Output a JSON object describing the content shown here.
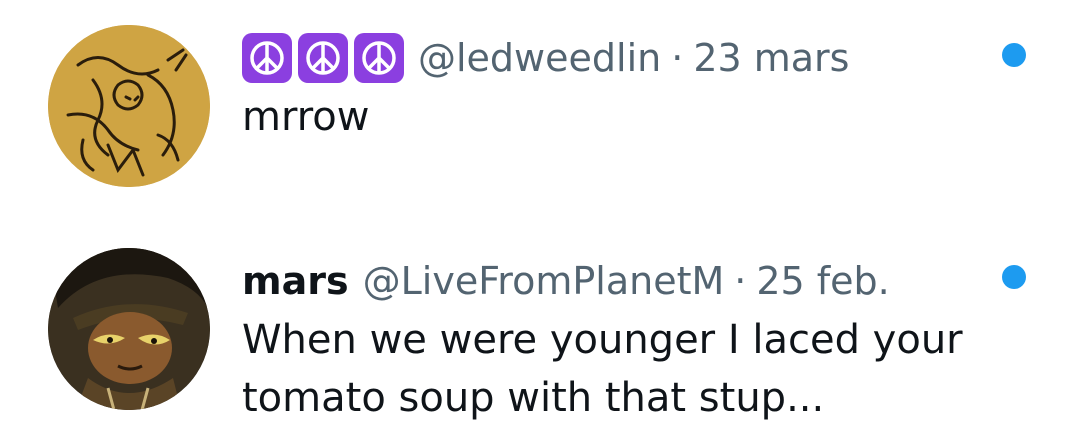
{
  "notifications": [
    {
      "display_name": "☮☮☮",
      "badge_icons": [
        "peace-symbol-icon",
        "peace-symbol-icon",
        "peace-symbol-icon"
      ],
      "handle": "@ledweedlin",
      "separator": "·",
      "date": "23 mars",
      "text": "mrrow",
      "unread": true
    },
    {
      "display_name": "mars",
      "handle": "@LiveFromPlanetM",
      "separator": "·",
      "date": "25 feb.",
      "text": "When we were younger I laced your tomato soup with that stup...",
      "unread": true
    }
  ],
  "colors": {
    "badge_purple": "#8b3fe0",
    "unread_blue": "#1d9bf0",
    "primary_text": "#0f1419",
    "secondary_text": "#536471"
  }
}
